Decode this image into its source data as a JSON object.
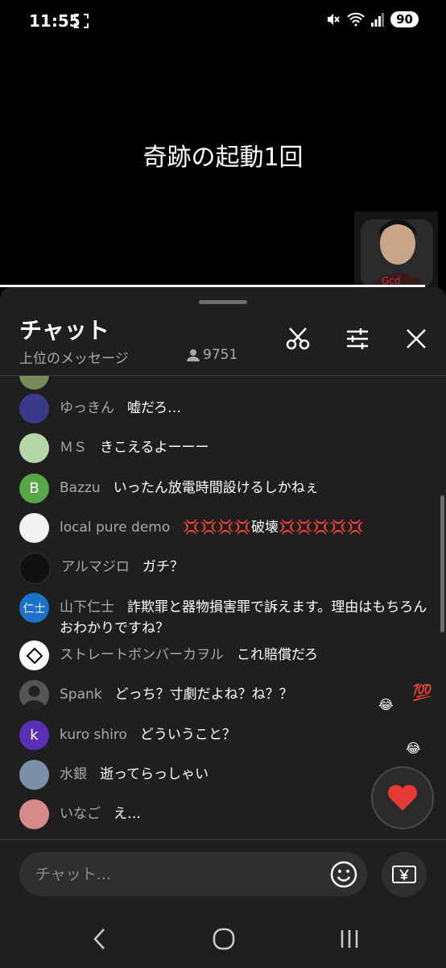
{
  "status_bar": {
    "time": "11:55",
    "battery": "90",
    "icons": [
      "screenshot-icon",
      "mute-icon",
      "wifi-icon",
      "signal-icon"
    ]
  },
  "video": {
    "title": "奇跡の起動1回"
  },
  "chat": {
    "title": "チャット",
    "subtitle": "上位のメッセージ",
    "viewer_count": "9751",
    "icons": [
      "scissors-icon",
      "sliders-icon",
      "close-icon"
    ],
    "messages": [
      {
        "author": "ゆっきん",
        "text": "嘘だろ…",
        "avatar_color": "#3b3a8a"
      },
      {
        "author": "ＭＳ",
        "text": "きこえるよーーー",
        "avatar_color": "#b7d7a8"
      },
      {
        "author": "Bazzu",
        "text": "いったん放電時間設けるしかねぇ",
        "avatar_color": "#57a648",
        "avatar_letter": "B"
      },
      {
        "author": "local pure demo",
        "text": "💢💢💢💢破壊💢💢💢💢💢",
        "avatar_color": "#f2f2f2"
      },
      {
        "author": "アルマジロ",
        "text": "ガチ？",
        "avatar_color": "#111111"
      },
      {
        "author": "山下仁士",
        "text": "詐欺罪と器物損害罪で訴えます。理由はもちろんおわかりですね？",
        "avatar_color": "#1a73c9",
        "avatar_letter": "仁士"
      },
      {
        "author": "ストレートボンバーカヲル",
        "text": "これ賠償だろ",
        "avatar_color": "#ffffff"
      },
      {
        "author": "Spank",
        "text": "どっち？寸劇だよね？ね？？",
        "avatar_color": "#555555"
      },
      {
        "author": "kuro shiro",
        "text": "どういうこと？",
        "avatar_color": "#5b2fb5",
        "avatar_letter": "k"
      },
      {
        "author": "水銀",
        "text": "逝ってらっしゃい",
        "avatar_color": "#7b8fa6"
      },
      {
        "author": "いなご",
        "text": "え…",
        "avatar_color": "#d8898a"
      }
    ],
    "input_placeholder": "チャット...",
    "reaction_emoji": [
      "💯",
      "😂",
      "😂"
    ]
  },
  "colors": {
    "panel_bg": "#1f1f1f",
    "author": "#aaaaaa",
    "heart": "#e53935"
  }
}
